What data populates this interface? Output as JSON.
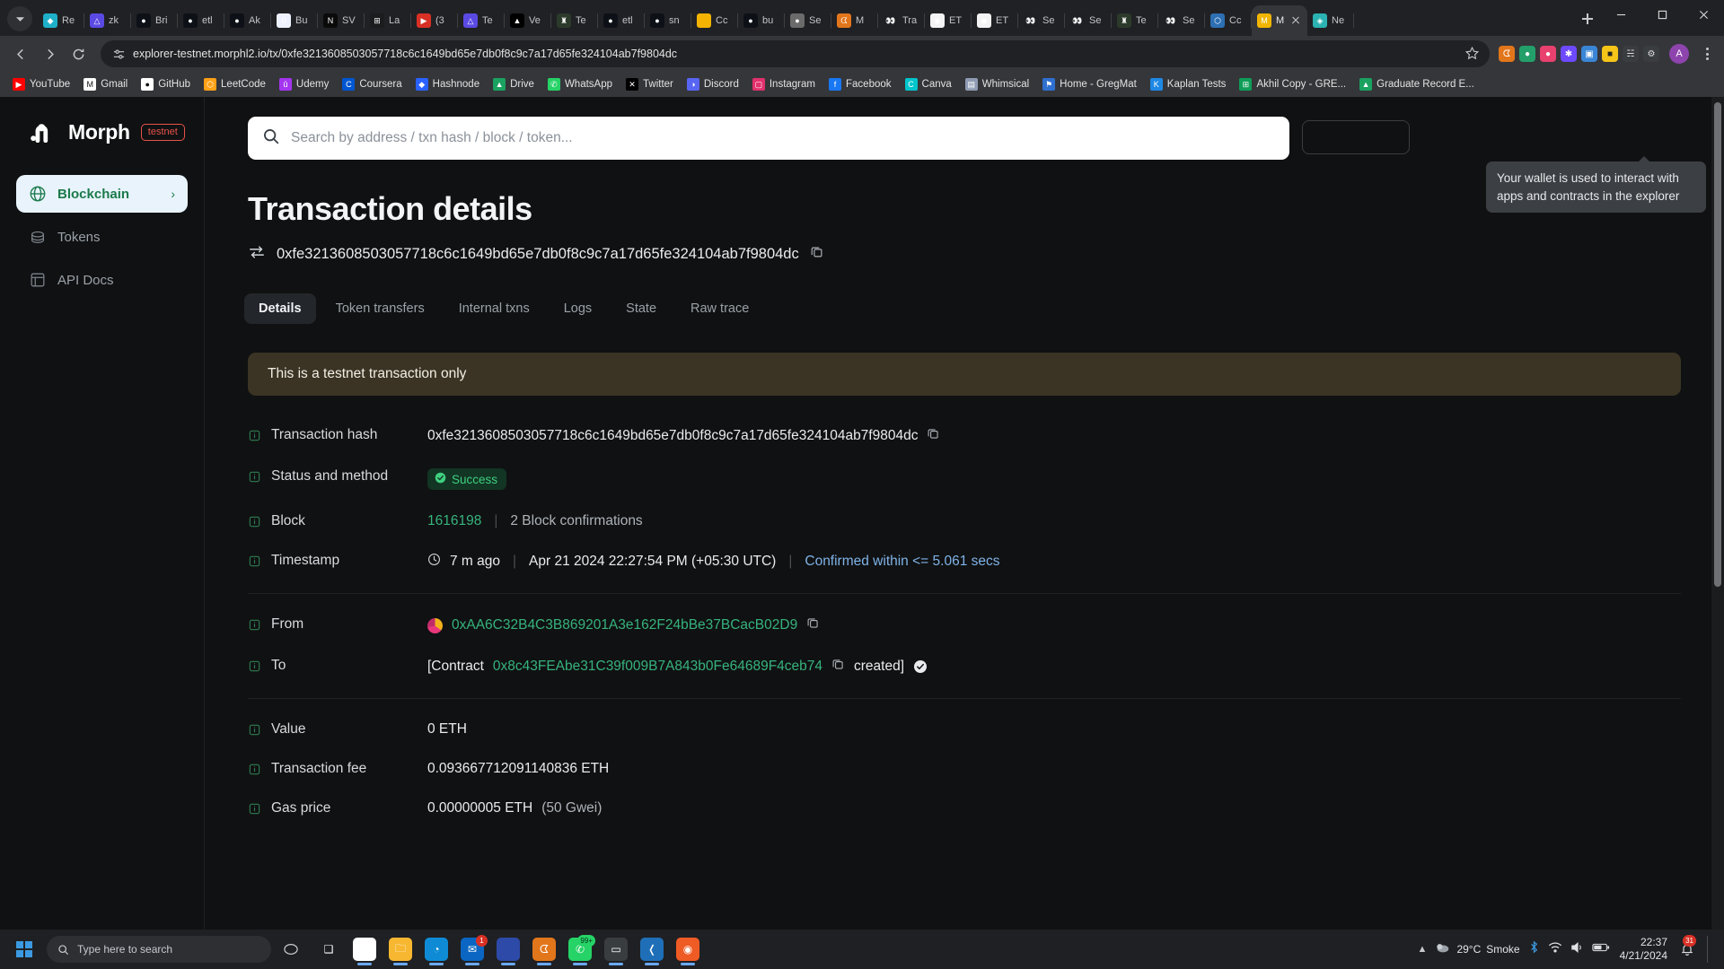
{
  "browser": {
    "tabs": [
      {
        "label": "Re",
        "icon": "ethereum-remix-icon",
        "color": "#1fb0c9",
        "glyph": "◆"
      },
      {
        "label": "zk",
        "icon": "zksync-icon",
        "color": "#5a4ae3",
        "glyph": "△"
      },
      {
        "label": "Bri",
        "icon": "github-icon",
        "color": "#0d1117",
        "glyph": "●"
      },
      {
        "label": "etl",
        "icon": "github-icon",
        "color": "#0d1117",
        "glyph": "●"
      },
      {
        "label": "Ak",
        "icon": "github-icon",
        "color": "#0d1117",
        "glyph": "●"
      },
      {
        "label": "Bu",
        "icon": "zero-icon",
        "color": "#eef2ff",
        "glyph": "0"
      },
      {
        "label": "SV",
        "icon": "notion-n-icon",
        "color": "#0a0a0a",
        "glyph": "N"
      },
      {
        "label": "La",
        "icon": "microsoft-icon",
        "color": "#1b1c1d",
        "glyph": "⊞"
      },
      {
        "label": "(3",
        "icon": "youtube-icon",
        "color": "#d93025",
        "glyph": "▶"
      },
      {
        "label": "Te",
        "icon": "zksync-icon",
        "color": "#5a4ae3",
        "glyph": "△"
      },
      {
        "label": "Ve",
        "icon": "vercel-icon",
        "color": "#000000",
        "glyph": "▲"
      },
      {
        "label": "Te",
        "icon": "tower-icon",
        "color": "#2b3a2b",
        "glyph": "♜"
      },
      {
        "label": "etl",
        "icon": "github-icon",
        "color": "#0d1117",
        "glyph": "●"
      },
      {
        "label": "sn",
        "icon": "github-icon",
        "color": "#0d1117",
        "glyph": "●"
      },
      {
        "label": "Cc",
        "icon": "yellow-square-icon",
        "color": "#f5b301",
        "glyph": " "
      },
      {
        "label": "bu",
        "icon": "github-icon",
        "color": "#0d1117",
        "glyph": "●"
      },
      {
        "label": "Se",
        "icon": "globe-icon",
        "color": "#6b6b6b",
        "glyph": "●"
      },
      {
        "label": "M",
        "icon": "metamask-icon",
        "color": "#e2761b",
        "glyph": "ᗧ"
      },
      {
        "label": "Tra",
        "icon": "eyes-icon",
        "color": "#1f2023",
        "glyph": "👀"
      },
      {
        "label": "ET",
        "icon": "etherscan-icon",
        "color": "#f3f3f3",
        "glyph": "◉"
      },
      {
        "label": "ET",
        "icon": "etherscan-icon",
        "color": "#f3f3f3",
        "glyph": "◉"
      },
      {
        "label": "Se",
        "icon": "eyes-icon",
        "color": "#1f2023",
        "glyph": "👀"
      },
      {
        "label": "Se",
        "icon": "eyes-icon",
        "color": "#1f2023",
        "glyph": "👀"
      },
      {
        "label": "Te",
        "icon": "tower-icon",
        "color": "#2b3a2b",
        "glyph": "♜"
      },
      {
        "label": "Se",
        "icon": "eyes-icon",
        "color": "#1f2023",
        "glyph": "👀"
      },
      {
        "label": "Cc",
        "icon": "arbitrum-icon",
        "color": "#2d6fb3",
        "glyph": "⬡"
      }
    ],
    "active_tab": {
      "label": "M",
      "icon": "morph-icon"
    },
    "last_tab": {
      "label": "Ne",
      "icon": "netlify-icon",
      "glyph": "◈",
      "color": "#2bb3b3"
    },
    "url": "explorer-testnet.morphl2.io/tx/0xfe3213608503057718c6c1649bd65e7db0f8c9c7a17d65fe324104ab7f9804dc",
    "avatar_letter": "A",
    "bookmarks": [
      {
        "label": "YouTube",
        "icon": "youtube-icon",
        "color": "#ff0000",
        "glyph": "▶"
      },
      {
        "label": "Gmail",
        "icon": "gmail-icon",
        "color": "#ffffff",
        "glyph": "M"
      },
      {
        "label": "GitHub",
        "icon": "github-icon",
        "color": "#ffffff",
        "glyph": "●"
      },
      {
        "label": "LeetCode",
        "icon": "leetcode-icon",
        "color": "#ffa116",
        "glyph": "⬡"
      },
      {
        "label": "Udemy",
        "icon": "udemy-icon",
        "color": "#a435f0",
        "glyph": "û"
      },
      {
        "label": "Coursera",
        "icon": "coursera-icon",
        "color": "#0056d2",
        "glyph": "C"
      },
      {
        "label": "Hashnode",
        "icon": "hashnode-icon",
        "color": "#2962ff",
        "glyph": "◆"
      },
      {
        "label": "Drive",
        "icon": "google-drive-icon",
        "color": "#1aa260",
        "glyph": "▲"
      },
      {
        "label": "WhatsApp",
        "icon": "whatsapp-icon",
        "color": "#25d366",
        "glyph": "✆"
      },
      {
        "label": "Twitter",
        "icon": "x-twitter-icon",
        "color": "#000000",
        "glyph": "✕"
      },
      {
        "label": "Discord",
        "icon": "discord-icon",
        "color": "#5865f2",
        "glyph": "◑"
      },
      {
        "label": "Instagram",
        "icon": "instagram-icon",
        "color": "#e1306c",
        "glyph": "▢"
      },
      {
        "label": "Facebook",
        "icon": "facebook-icon",
        "color": "#1877f2",
        "glyph": "f"
      },
      {
        "label": "Canva",
        "icon": "canva-icon",
        "color": "#00c4cc",
        "glyph": "C"
      },
      {
        "label": "Whimsical",
        "icon": "whimsical-icon",
        "color": "#8f9bb3",
        "glyph": "▤"
      },
      {
        "label": "Home - GregMat",
        "icon": "gregmat-icon",
        "color": "#2f6fd0",
        "glyph": "⚑"
      },
      {
        "label": "Kaplan Tests",
        "icon": "kaplan-icon",
        "color": "#1e88e5",
        "glyph": "K"
      },
      {
        "label": "Akhil Copy - GRE...",
        "icon": "google-sheets-icon",
        "color": "#0f9d58",
        "glyph": "⊞"
      },
      {
        "label": "Graduate Record E...",
        "icon": "google-drive-icon",
        "color": "#1aa260",
        "glyph": "▲"
      }
    ]
  },
  "sidebar": {
    "brand": "Morph",
    "badge": "testnet",
    "items": [
      {
        "label": "Blockchain",
        "icon": "globe-icon",
        "active": true,
        "chevron": "›"
      },
      {
        "label": "Tokens",
        "icon": "coins-icon",
        "active": false,
        "chevron": ""
      },
      {
        "label": "API Docs",
        "icon": "document-icon",
        "active": false,
        "chevron": ""
      }
    ]
  },
  "search": {
    "placeholder": "Search by address / txn hash / block / token...",
    "icon": "search-icon"
  },
  "wallet": {
    "tooltip": "Your wallet is used to interact with apps and contracts in the explorer",
    "button_label": ""
  },
  "page": {
    "title": "Transaction details",
    "hash": "0xfe3213608503057718c6c1649bd65e7db0f8c9c7a17d65fe324104ab7f9804dc",
    "banner": "This is a testnet transaction only",
    "tabs": [
      {
        "label": "Details",
        "active": true
      },
      {
        "label": "Token transfers",
        "active": false
      },
      {
        "label": "Internal txns",
        "active": false
      },
      {
        "label": "Logs",
        "active": false
      },
      {
        "label": "State",
        "active": false
      },
      {
        "label": "Raw trace",
        "active": false
      }
    ]
  },
  "details": {
    "transaction_hash": {
      "label": "Transaction hash",
      "value": "0xfe3213608503057718c6c1649bd65e7db0f8c9c7a17d65fe324104ab7f9804dc"
    },
    "status": {
      "label": "Status and method",
      "value": "Success"
    },
    "block": {
      "label": "Block",
      "number": "1616198",
      "confirmations": "2 Block confirmations"
    },
    "timestamp": {
      "label": "Timestamp",
      "relative": "7 m ago",
      "absolute": "Apr 21 2024 22:27:54 PM (+05:30 UTC)",
      "confirmed": "Confirmed within <= 5.061 secs"
    },
    "from": {
      "label": "From",
      "address": "0xAA6C32B4C3B869201A3e162F24bBe37BCacB02D9"
    },
    "to": {
      "label": "To",
      "prefix": "[Contract",
      "address": "0x8c43FEAbe31C39f009B7A843b0Fe64689F4ceb74",
      "suffix": "created]"
    },
    "value": {
      "label": "Value",
      "value": "0 ETH"
    },
    "transaction_fee": {
      "label": "Transaction fee",
      "value": "0.093667712091140836 ETH"
    },
    "gas_price": {
      "label": "Gas price",
      "value": "0.00000005 ETH",
      "gwei": "(50 Gwei)"
    }
  },
  "taskbar": {
    "search_placeholder": "Type here to search",
    "weather": {
      "temp": "29°C",
      "desc": "Smoke"
    },
    "time": "22:37",
    "date": "4/21/2024",
    "notification_count": "31",
    "apps": [
      {
        "name": "task-view",
        "glyph": "❑",
        "color": "transparent"
      },
      {
        "name": "google-chrome",
        "glyph": "◎",
        "color": "#ffffff"
      },
      {
        "name": "file-explorer",
        "glyph": "🗀",
        "color": "#f7b731"
      },
      {
        "name": "microsoft-edge",
        "glyph": "◔",
        "color": "#0f8bd6"
      },
      {
        "name": "mail",
        "glyph": "✉",
        "color": "#0a66c2",
        "badge": "1"
      },
      {
        "name": "morph-explorer",
        "glyph": " ",
        "color": "#2d4aa8"
      },
      {
        "name": "metamask",
        "glyph": "ᗧ",
        "color": "#e2761b"
      },
      {
        "name": "whatsapp",
        "glyph": "✆",
        "color": "#25d366",
        "badge": "99+"
      },
      {
        "name": "terminal",
        "glyph": "▭",
        "color": "#3a3d40"
      },
      {
        "name": "vs-code",
        "glyph": "❬",
        "color": "#1f6fb8"
      },
      {
        "name": "postman",
        "glyph": "◉",
        "color": "#ef5b25"
      }
    ]
  }
}
